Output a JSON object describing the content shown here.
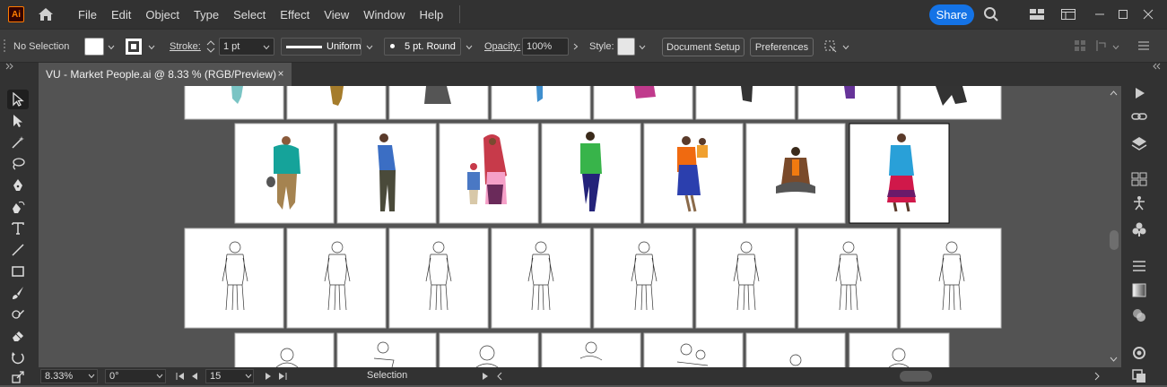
{
  "app": {
    "logo": "Ai"
  },
  "menu": [
    "File",
    "Edit",
    "Object",
    "Type",
    "Select",
    "Effect",
    "View",
    "Window",
    "Help"
  ],
  "share_label": "Share",
  "control": {
    "selection": "No Selection",
    "stroke_label": "Stroke:",
    "stroke_value": "1 pt",
    "profile": "Uniform",
    "brush": "5 pt. Round",
    "opacity_label": "Opacity:",
    "opacity_value": "100%",
    "style_label": "Style:",
    "doc_setup": "Document Setup",
    "preferences": "Preferences"
  },
  "document_tab": {
    "title": "VU - Market People.ai @ 8.33 % (RGB/Preview)",
    "close": "×"
  },
  "status": {
    "zoom": "8.33%",
    "rotation": "0°",
    "artboard": "15",
    "tool": "Selection"
  },
  "colors": {
    "accent": "#1473e6",
    "brand": "#ff7c00"
  },
  "icons": {
    "tools": [
      "selection-icon",
      "direct-selection-icon",
      "magic-wand-icon",
      "lasso-icon",
      "pen-icon",
      "curvature-icon",
      "type-icon",
      "line-icon",
      "rectangle-icon",
      "paintbrush-icon",
      "shaper-icon",
      "eraser-icon",
      "rotate-icon",
      "scale-icon"
    ],
    "right_panel": [
      "play-icon",
      "link-icon",
      "layers-icon",
      "artboards-icon",
      "puppet-icon",
      "symbols-icon",
      "align-icon",
      "gradient-icon",
      "transparency-icon",
      "appearance-icon",
      "graphic-styles-icon"
    ]
  }
}
